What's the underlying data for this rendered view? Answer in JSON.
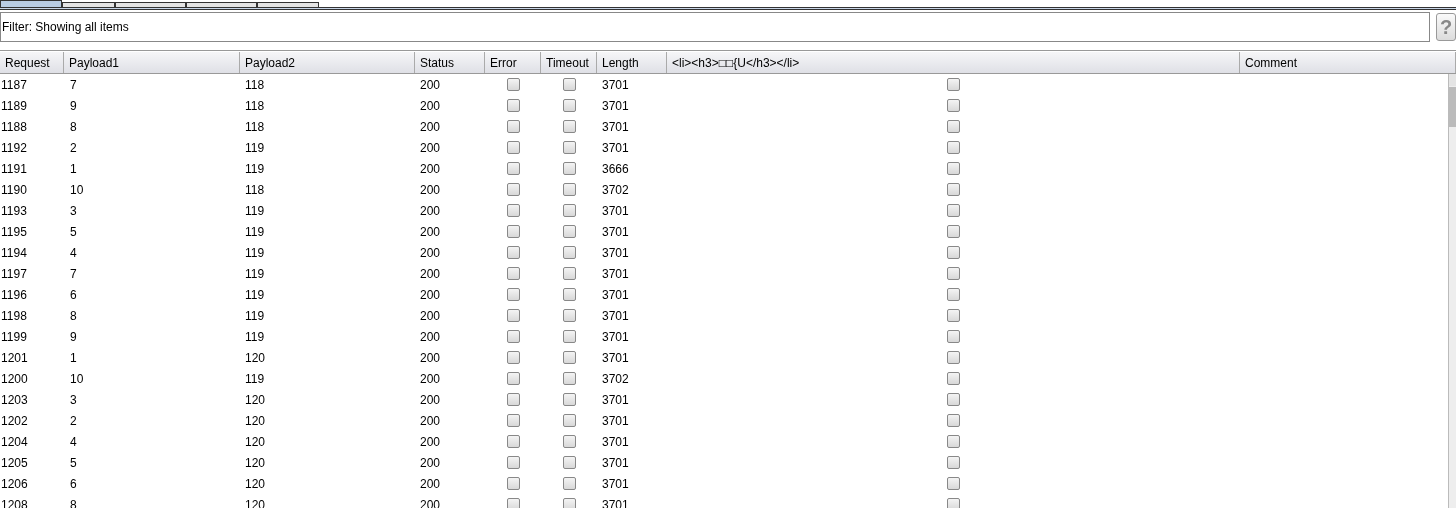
{
  "tabs": [
    {
      "selected": true
    },
    {
      "selected": false
    },
    {
      "selected": false
    },
    {
      "selected": false
    },
    {
      "selected": false
    }
  ],
  "filter": {
    "text": "Filter: Showing all items"
  },
  "help_button": {
    "label": "?"
  },
  "table": {
    "columns": [
      "Request",
      "Payload1",
      "Payload2",
      "Status",
      "Error",
      "Timeout",
      "Length",
      "<li><h3>□□{U</h3></li>",
      "Comment"
    ],
    "rows": [
      {
        "request": "1187",
        "payload1": "7",
        "payload2": "118",
        "status": "200",
        "error": false,
        "timeout": false,
        "length": "3701",
        "match": false
      },
      {
        "request": "1189",
        "payload1": "9",
        "payload2": "118",
        "status": "200",
        "error": false,
        "timeout": false,
        "length": "3701",
        "match": false
      },
      {
        "request": "1188",
        "payload1": "8",
        "payload2": "118",
        "status": "200",
        "error": false,
        "timeout": false,
        "length": "3701",
        "match": false
      },
      {
        "request": "1192",
        "payload1": "2",
        "payload2": "119",
        "status": "200",
        "error": false,
        "timeout": false,
        "length": "3701",
        "match": false
      },
      {
        "request": "1191",
        "payload1": "1",
        "payload2": "119",
        "status": "200",
        "error": false,
        "timeout": false,
        "length": "3666",
        "match": false
      },
      {
        "request": "1190",
        "payload1": "10",
        "payload2": "118",
        "status": "200",
        "error": false,
        "timeout": false,
        "length": "3702",
        "match": false
      },
      {
        "request": "1193",
        "payload1": "3",
        "payload2": "119",
        "status": "200",
        "error": false,
        "timeout": false,
        "length": "3701",
        "match": false
      },
      {
        "request": "1195",
        "payload1": "5",
        "payload2": "119",
        "status": "200",
        "error": false,
        "timeout": false,
        "length": "3701",
        "match": false
      },
      {
        "request": "1194",
        "payload1": "4",
        "payload2": "119",
        "status": "200",
        "error": false,
        "timeout": false,
        "length": "3701",
        "match": false
      },
      {
        "request": "1197",
        "payload1": "7",
        "payload2": "119",
        "status": "200",
        "error": false,
        "timeout": false,
        "length": "3701",
        "match": false
      },
      {
        "request": "1196",
        "payload1": "6",
        "payload2": "119",
        "status": "200",
        "error": false,
        "timeout": false,
        "length": "3701",
        "match": false
      },
      {
        "request": "1198",
        "payload1": "8",
        "payload2": "119",
        "status": "200",
        "error": false,
        "timeout": false,
        "length": "3701",
        "match": false
      },
      {
        "request": "1199",
        "payload1": "9",
        "payload2": "119",
        "status": "200",
        "error": false,
        "timeout": false,
        "length": "3701",
        "match": false
      },
      {
        "request": "1201",
        "payload1": "1",
        "payload2": "120",
        "status": "200",
        "error": false,
        "timeout": false,
        "length": "3701",
        "match": false
      },
      {
        "request": "1200",
        "payload1": "10",
        "payload2": "119",
        "status": "200",
        "error": false,
        "timeout": false,
        "length": "3702",
        "match": false
      },
      {
        "request": "1203",
        "payload1": "3",
        "payload2": "120",
        "status": "200",
        "error": false,
        "timeout": false,
        "length": "3701",
        "match": false
      },
      {
        "request": "1202",
        "payload1": "2",
        "payload2": "120",
        "status": "200",
        "error": false,
        "timeout": false,
        "length": "3701",
        "match": false
      },
      {
        "request": "1204",
        "payload1": "4",
        "payload2": "120",
        "status": "200",
        "error": false,
        "timeout": false,
        "length": "3701",
        "match": false
      },
      {
        "request": "1205",
        "payload1": "5",
        "payload2": "120",
        "status": "200",
        "error": false,
        "timeout": false,
        "length": "3701",
        "match": false
      },
      {
        "request": "1206",
        "payload1": "6",
        "payload2": "120",
        "status": "200",
        "error": false,
        "timeout": false,
        "length": "3701",
        "match": false
      },
      {
        "request": "1208",
        "payload1": "8",
        "payload2": "120",
        "status": "200",
        "error": false,
        "timeout": false,
        "length": "3701",
        "match": false
      }
    ]
  }
}
